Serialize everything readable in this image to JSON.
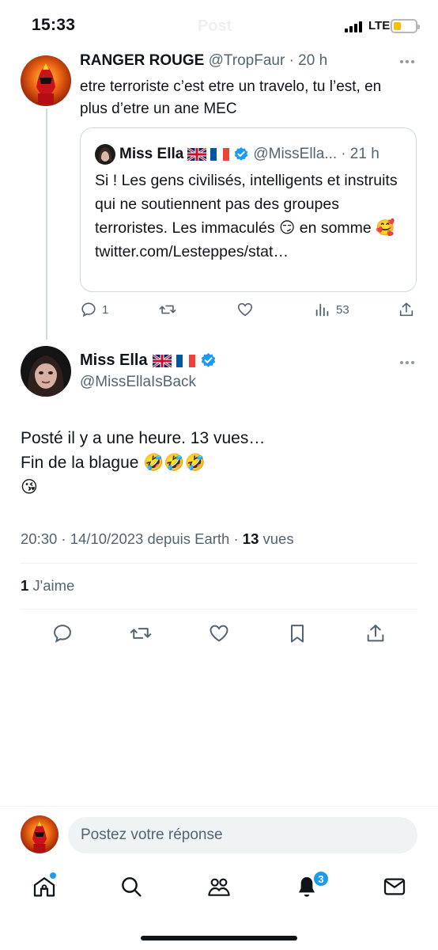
{
  "status_bar": {
    "time": "15:33",
    "network": "LTE",
    "faded_title": "Post"
  },
  "colors": {
    "accent": "#1d9bf0",
    "text_primary": "#0f1419",
    "text_secondary": "#536471",
    "divider": "#eff3f4",
    "battery": "#f2c200"
  },
  "reply_tweet": {
    "name": "RANGER ROUGE",
    "handle": "@TropFaur",
    "time": "· 20 h",
    "text": "etre terroriste c’est etre un travelo, tu l’est, en plus d’etre un ane MEC",
    "quoted": {
      "name": "Miss Ella",
      "flags": [
        "uk-flag-icon",
        "fr-flag-icon"
      ],
      "handle": "@MissElla...",
      "time": "· 21 h",
      "text": "Si ! Les gens civilisés, intelligents et instruits qui ne soutiennent pas des groupes terroristes. Les immaculés 😏 en somme 🥰 twitter.com/Lesteppes/stat…"
    },
    "actions": {
      "replies": "1",
      "views": "53"
    }
  },
  "main_tweet": {
    "name": "Miss Ella",
    "handle": "@MissEllaIsBack",
    "text_line1": "Posté il y a une heure. 13 vues…",
    "text_line2": "Fin de la blague 🤣🤣🤣",
    "text_line3": "😘",
    "meta_time": "20:30 · 14/10/2023 depuis Earth · ",
    "meta_views_count": "13",
    "meta_views_label": " vues",
    "likes_count": "1",
    "likes_label": " J'aime"
  },
  "composer": {
    "placeholder": "Postez votre réponse"
  },
  "bottom_nav": {
    "notifications_badge": "3",
    "items": [
      "home-icon",
      "search-icon",
      "communities-icon",
      "notifications-icon",
      "messages-icon"
    ]
  }
}
